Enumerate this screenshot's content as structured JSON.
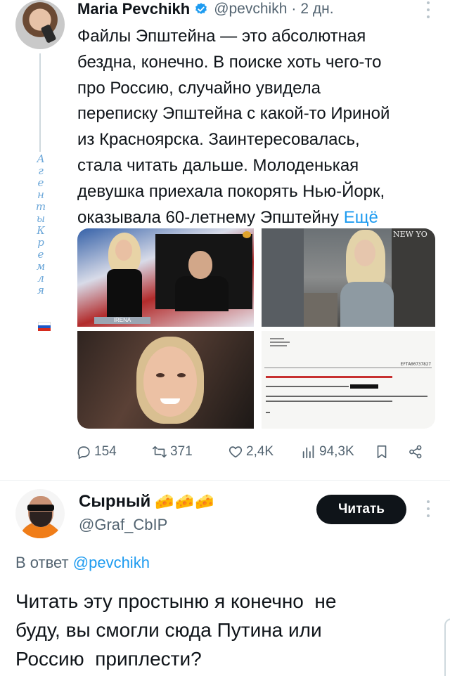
{
  "tweet": {
    "author_name": "Maria Pevchikh",
    "handle": "@pevchikh",
    "separator": "·",
    "time": "2 дн.",
    "text_lines": [
      "Файлы Эпштейна — это абсолютная",
      "бездна, конечно. В поиске хоть чего-то",
      "про Россию, случайно увидела",
      "переписку Эпштейна с какой-то Ириной",
      "из Красноярска. Заинтересовалась,",
      "стала читать дальше. Молоденькая",
      "девушка приехала покорять Нью-Йорк,"
    ],
    "last_line": "оказывала 60-летнему Эпштейну",
    "show_more": "Ещё",
    "bio_vertical": [
      "А",
      "г",
      "е",
      "н",
      "т",
      "ы",
      "К",
      "р",
      "е",
      "м",
      "л",
      "я"
    ],
    "media": {
      "photo1_caption": "IRENA",
      "photo2_sign": "NEW YO",
      "photo4_docid": "EFTA00737827"
    },
    "stats": {
      "replies": "154",
      "reposts": "371",
      "likes": "2,4K",
      "views": "94,3K"
    },
    "colors": {
      "accent": "#1d9bf0",
      "verified": "#1d9bf0",
      "muted": "#536471"
    }
  },
  "reply": {
    "author_name": "Сырный",
    "author_emoji": "🧀🧀🧀",
    "handle": "@Graf_CbIP",
    "follow_label": "Читать",
    "in_reply_prefix": "В ответ",
    "in_reply_mention": "@pevchikh",
    "text_lines": [
      "Читать эту простыню я конечно  не",
      "буду, вы смогли сюда Путина или",
      "Россию  приплести?"
    ]
  }
}
